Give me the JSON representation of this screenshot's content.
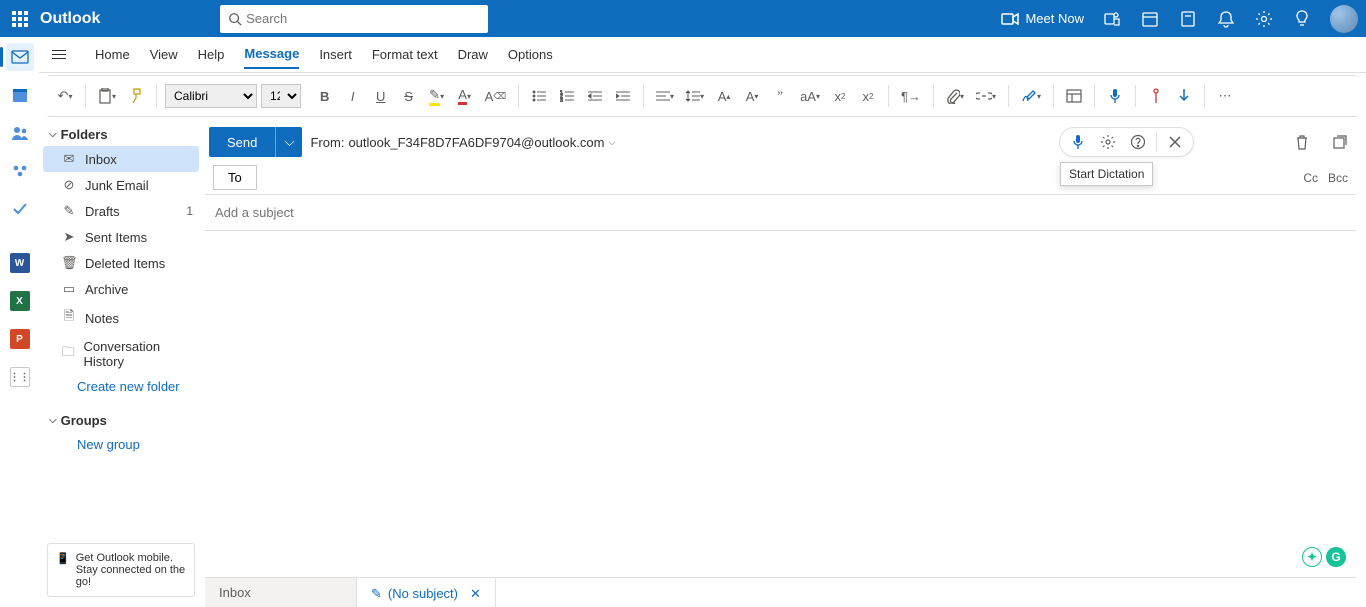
{
  "header": {
    "app_name": "Outlook",
    "search_placeholder": "Search",
    "meet_now": "Meet Now"
  },
  "ribbon": {
    "tabs": [
      "Home",
      "View",
      "Help",
      "Message",
      "Insert",
      "Format text",
      "Draw",
      "Options"
    ],
    "active_tab": "Message",
    "font_name": "Calibri",
    "font_size": "12"
  },
  "folders": {
    "section_label": "Folders",
    "items": [
      {
        "label": "Inbox",
        "icon": "inbox",
        "selected": true
      },
      {
        "label": "Junk Email",
        "icon": "junk"
      },
      {
        "label": "Drafts",
        "icon": "drafts",
        "count": "1"
      },
      {
        "label": "Sent Items",
        "icon": "sent"
      },
      {
        "label": "Deleted Items",
        "icon": "trash"
      },
      {
        "label": "Archive",
        "icon": "archive"
      },
      {
        "label": "Notes",
        "icon": "notes"
      },
      {
        "label": "Conversation History",
        "icon": "history"
      }
    ],
    "create_link": "Create new folder",
    "groups_label": "Groups",
    "new_group": "New group",
    "mobile_promo": "Get Outlook mobile. Stay connected on the go!"
  },
  "rail": {
    "items": [
      "mail",
      "calendar",
      "people",
      "groups",
      "todo",
      "word",
      "excel",
      "powerpoint",
      "more"
    ]
  },
  "compose": {
    "send": "Send",
    "from_label": "From:",
    "from_address": "outlook_F34F8D7FA6DF9704@outlook.com",
    "to_label": "To",
    "cc": "Cc",
    "bcc": "Bcc",
    "subject_placeholder": "Add a subject",
    "dictation_tooltip": "Start Dictation"
  },
  "bottom_tabs": {
    "inbox": "Inbox",
    "draft": "(No subject)"
  }
}
